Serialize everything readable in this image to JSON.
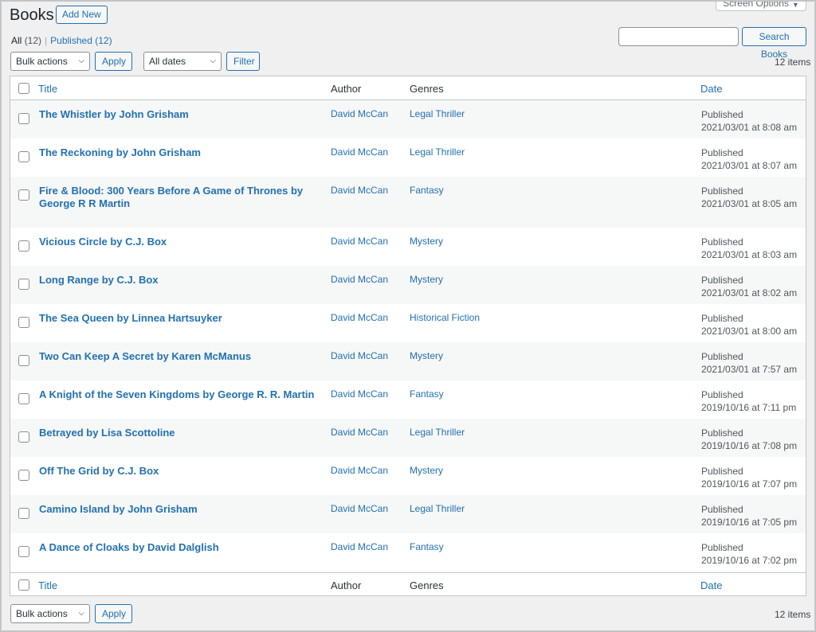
{
  "header": {
    "title": "Books",
    "add_new_label": "Add New",
    "screen_options_label": "Screen Options"
  },
  "views": {
    "all_label": "All",
    "all_count": "(12)",
    "published_label": "Published",
    "published_count": "(12)"
  },
  "search": {
    "value": "",
    "button_label": "Search Books"
  },
  "top_nav": {
    "bulk_actions": "Bulk actions",
    "apply_label": "Apply",
    "dates_filter": "All dates",
    "filter_label": "Filter",
    "items_count": "12 items"
  },
  "columns": {
    "title": "Title",
    "author": "Author",
    "genres": "Genres",
    "date": "Date"
  },
  "rows": [
    {
      "title": "The Whistler by John Grisham",
      "author": "David McCan",
      "genre": "Legal Thriller",
      "status": "Published",
      "date": "2021/03/01 at 8:08 am"
    },
    {
      "title": "The Reckoning by John Grisham",
      "author": "David McCan",
      "genre": "Legal Thriller",
      "status": "Published",
      "date": "2021/03/01 at 8:07 am"
    },
    {
      "title": "Fire & Blood: 300 Years Before A Game of Thrones by George R R Martin",
      "author": "David McCan",
      "genre": "Fantasy",
      "status": "Published",
      "date": "2021/03/01 at 8:05 am"
    },
    {
      "title": "Vicious Circle by C.J. Box",
      "author": "David McCan",
      "genre": "Mystery",
      "status": "Published",
      "date": "2021/03/01 at 8:03 am"
    },
    {
      "title": "Long Range by C.J. Box",
      "author": "David McCan",
      "genre": "Mystery",
      "status": "Published",
      "date": "2021/03/01 at 8:02 am"
    },
    {
      "title": "The Sea Queen by Linnea Hartsuyker",
      "author": "David McCan",
      "genre": "Historical Fiction",
      "status": "Published",
      "date": "2021/03/01 at 8:00 am"
    },
    {
      "title": "Two Can Keep A Secret by Karen McManus",
      "author": "David McCan",
      "genre": "Mystery",
      "status": "Published",
      "date": "2021/03/01 at 7:57 am"
    },
    {
      "title": "A Knight of the Seven Kingdoms by George R. R. Martin",
      "author": "David McCan",
      "genre": "Fantasy",
      "status": "Published",
      "date": "2019/10/16 at 7:11 pm"
    },
    {
      "title": "Betrayed by Lisa Scottoline",
      "author": "David McCan",
      "genre": "Legal Thriller",
      "status": "Published",
      "date": "2019/10/16 at 7:08 pm"
    },
    {
      "title": "Off The Grid by C.J. Box",
      "author": "David McCan",
      "genre": "Mystery",
      "status": "Published",
      "date": "2019/10/16 at 7:07 pm"
    },
    {
      "title": "Camino Island by John Grisham",
      "author": "David McCan",
      "genre": "Legal Thriller",
      "status": "Published",
      "date": "2019/10/16 at 7:05 pm"
    },
    {
      "title": "A Dance of Cloaks by David Dalglish",
      "author": "David McCan",
      "genre": "Fantasy",
      "status": "Published",
      "date": "2019/10/16 at 7:02 pm"
    }
  ],
  "bottom_nav": {
    "bulk_actions": "Bulk actions",
    "apply_label": "Apply",
    "items_count": "12 items"
  },
  "colors": {
    "link": "#2271b1",
    "background": "#f0f0f1",
    "row_alt": "#f6f7f7",
    "border": "#c3c4c7"
  }
}
